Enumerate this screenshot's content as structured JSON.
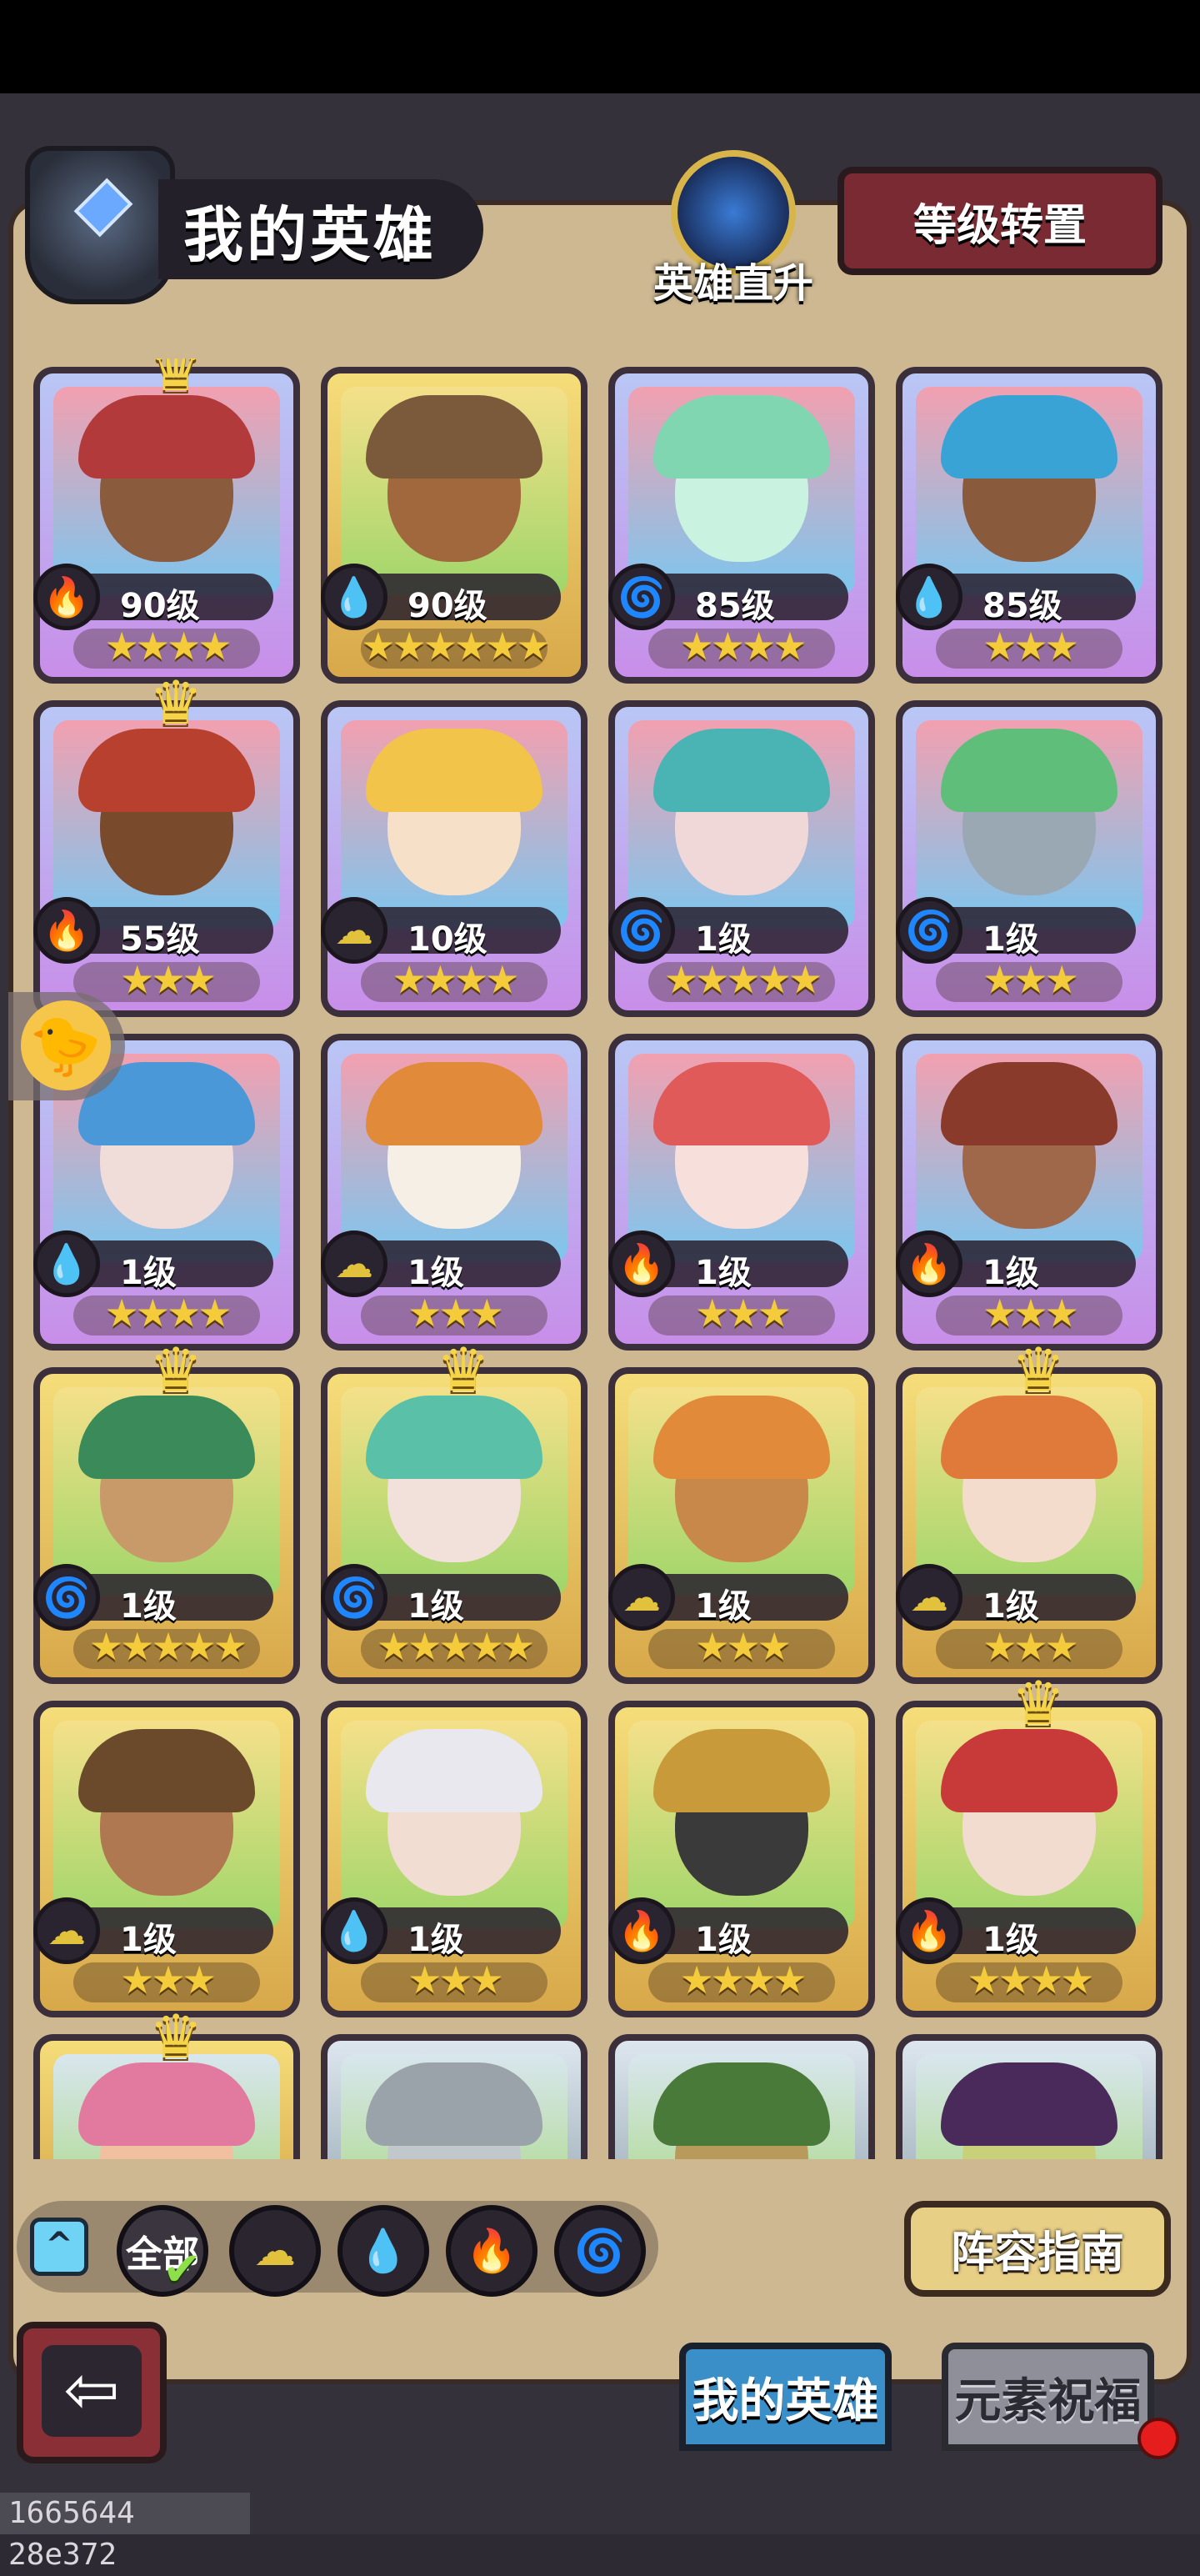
{
  "header": {
    "title": "我的英雄",
    "promote_label": "英雄直升",
    "reset_button": "等级转置"
  },
  "colors": {
    "fire": "#e8585d",
    "water": "#4aa6e3",
    "wind": "#5fbe3e",
    "earth": "#e2c23c",
    "purple_frame": "#c88ee9",
    "gold_frame": "#d8a84a"
  },
  "heroes": [
    {
      "level": "90级",
      "element": "fire",
      "stars": "★★★★",
      "frame": "purple",
      "crown": true
    },
    {
      "level": "90级",
      "element": "water",
      "stars": "★★★★★★",
      "frame": "gold",
      "crown": false
    },
    {
      "level": "85级",
      "element": "wind",
      "stars": "★★★★",
      "frame": "purple",
      "crown": false
    },
    {
      "level": "85级",
      "element": "water",
      "stars": "★★★",
      "frame": "purple",
      "crown": false
    },
    {
      "level": "55级",
      "element": "fire",
      "stars": "★★★",
      "frame": "purple",
      "crown": true
    },
    {
      "level": "10级",
      "element": "earth",
      "stars": "★★★★",
      "frame": "purple",
      "crown": false
    },
    {
      "level": "1级",
      "element": "wind",
      "stars": "★★★★★",
      "frame": "purple",
      "crown": false
    },
    {
      "level": "1级",
      "element": "wind",
      "stars": "★★★",
      "frame": "purple",
      "crown": false
    },
    {
      "level": "1级",
      "element": "water",
      "stars": "★★★★",
      "frame": "purple",
      "crown": false
    },
    {
      "level": "1级",
      "element": "earth",
      "stars": "★★★",
      "frame": "purple",
      "crown": false
    },
    {
      "level": "1级",
      "element": "fire",
      "stars": "★★★",
      "frame": "purple",
      "crown": false
    },
    {
      "level": "1级",
      "element": "fire",
      "stars": "★★★",
      "frame": "purple",
      "crown": false
    },
    {
      "level": "1级",
      "element": "wind",
      "stars": "★★★★★",
      "frame": "gold",
      "crown": true
    },
    {
      "level": "1级",
      "element": "wind",
      "stars": "★★★★★",
      "frame": "gold",
      "crown": true
    },
    {
      "level": "1级",
      "element": "earth",
      "stars": "★★★",
      "frame": "gold",
      "crown": false
    },
    {
      "level": "1级",
      "element": "earth",
      "stars": "★★★",
      "frame": "gold",
      "crown": true
    },
    {
      "level": "1级",
      "element": "earth",
      "stars": "★★★",
      "frame": "gold",
      "crown": false
    },
    {
      "level": "1级",
      "element": "water",
      "stars": "★★★",
      "frame": "gold",
      "crown": false
    },
    {
      "level": "1级",
      "element": "fire",
      "stars": "★★★★",
      "frame": "gold",
      "crown": false
    },
    {
      "level": "1级",
      "element": "fire",
      "stars": "★★★★",
      "frame": "gold",
      "crown": true
    }
  ],
  "filters": {
    "all_label": "全部",
    "icons": [
      "earth-icon",
      "water-icon",
      "fire-icon",
      "wind-icon"
    ]
  },
  "guide_button": "阵容指南",
  "tabs": {
    "my_heroes": "我的英雄",
    "element_blessing": "元素祝福"
  },
  "footer_id": "1665644 28e372"
}
